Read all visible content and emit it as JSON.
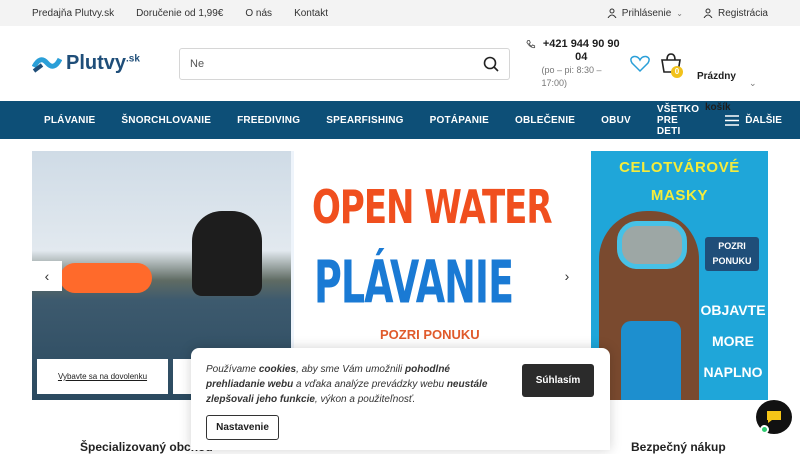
{
  "topbar": {
    "links": [
      "Predajňa Plutvy.sk",
      "Doručenie od 1,99€",
      "O nás",
      "Kontakt"
    ],
    "login": "Prihlásenie",
    "register": "Registrácia"
  },
  "header": {
    "logo": "Plutvy",
    "logo_tld": ".sk",
    "search_placeholder": "Ne",
    "phone": "+421 944 90 90 04",
    "hours": "(po – pi: 8:30 – 17:00)",
    "cart_count": "0",
    "cart_label_1": "Prázdny",
    "cart_label_2": "košík"
  },
  "nav": {
    "items": [
      "PLÁVANIE",
      "ŠNORCHLOVANIE",
      "FREEDIVING",
      "SPEARFISHING",
      "POTÁPANIE",
      "OBLEČENIE",
      "OBUV",
      "VŠETKO PRE DETI"
    ],
    "more": "ĎALŠIE"
  },
  "banner": {
    "line1": "OPEN WATER",
    "line2": "PLÁVANIE",
    "cta": "POZRI PONUKU",
    "vybavte": "Vybavte sa na dovolenku"
  },
  "side_banner": {
    "title1": "CELOTVÁROVÉ",
    "title2": "MASKY",
    "pozri1": "POZRI",
    "pozri2": "PONUKU",
    "obj1": "OBJAVTE",
    "obj2": "MORE",
    "obj3": "NAPLNO"
  },
  "bottom": {
    "left": "Špecializovaný obchod",
    "right": "Bezpečný nákup"
  },
  "cookie": {
    "p1": "Používame ",
    "b1": "cookies",
    "p2": ", aby sme Vám umožnili ",
    "b2": "pohodlné prehliadanie webu",
    "p3": " a vďaka analýze prevádzky webu ",
    "b3": "neustále zlepšovali jeho funkcie",
    "p4": ", výkon a použiteľnosť.",
    "accept": "Súhlasím",
    "settings": "Nastavenie"
  },
  "colors": {
    "nav": "#0d4f77",
    "accent": "#f2c21b",
    "orange": "#f04f1e",
    "blue": "#1a7ad4"
  }
}
